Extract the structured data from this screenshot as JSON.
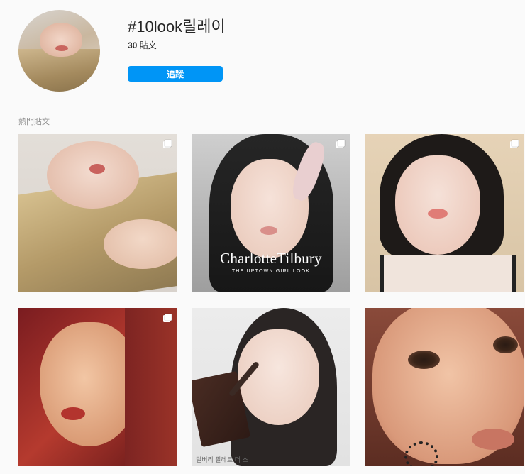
{
  "header": {
    "hashtag": "#10look릴레이",
    "post_count": "30",
    "post_label": "貼文",
    "follow_label": "追蹤"
  },
  "section": {
    "title": "熱門貼文"
  },
  "posts": [
    {
      "type": "carousel",
      "icon": "multiple-images-icon",
      "overlay_title": "",
      "overlay_subtitle": "",
      "caption": ""
    },
    {
      "type": "carousel",
      "icon": "multiple-images-icon",
      "overlay_title": "CharlotteTilbury",
      "overlay_subtitle": "THE UPTOWN GIRL LOOK",
      "caption": ""
    },
    {
      "type": "carousel",
      "icon": "multiple-images-icon",
      "overlay_title": "",
      "overlay_subtitle": "",
      "caption": ""
    },
    {
      "type": "carousel",
      "icon": "multiple-images-icon",
      "overlay_title": "",
      "overlay_subtitle": "",
      "caption": ""
    },
    {
      "type": "single",
      "icon": "",
      "overlay_title": "",
      "overlay_subtitle": "",
      "caption": "틸버리 팔레트 더 스"
    },
    {
      "type": "single",
      "icon": "",
      "overlay_title": "",
      "overlay_subtitle": "",
      "caption": ""
    }
  ],
  "colors": {
    "background": "#fafafa",
    "accent": "#0095f6",
    "text": "#262626",
    "muted": "#8e8e8e"
  }
}
